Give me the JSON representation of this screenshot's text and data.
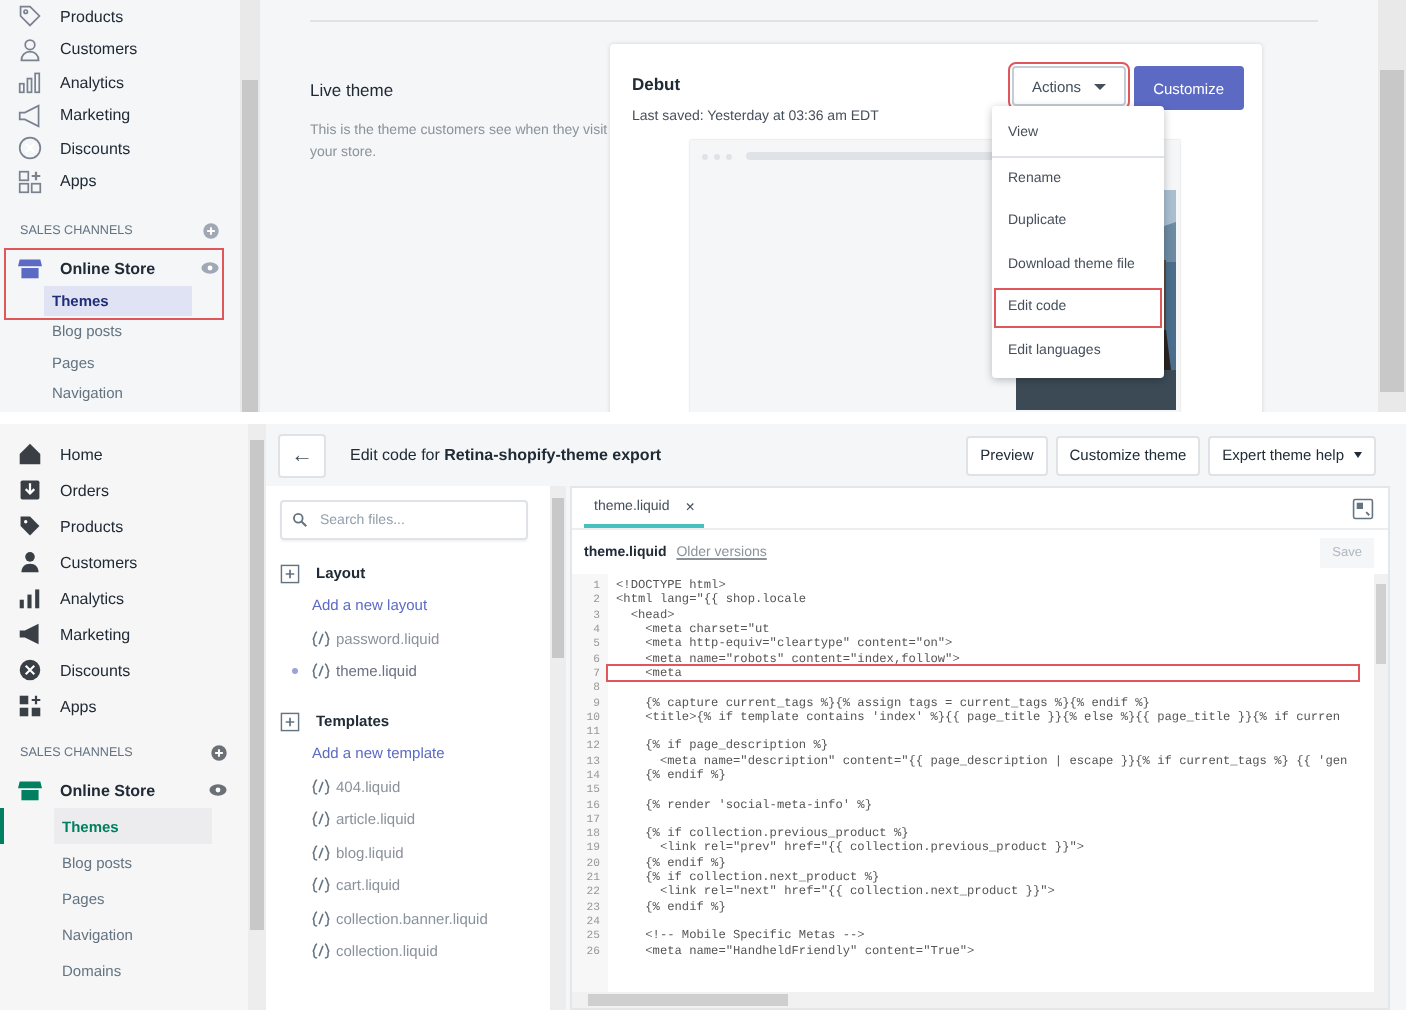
{
  "theme_admin": {
    "sidebar": {
      "items": [
        {
          "label": "Products"
        },
        {
          "label": "Customers"
        },
        {
          "label": "Analytics"
        },
        {
          "label": "Marketing"
        },
        {
          "label": "Discounts"
        },
        {
          "label": "Apps"
        }
      ],
      "section_title": "SALES CHANNELS",
      "channel": {
        "label": "Online Store",
        "highlighted": true,
        "children": [
          {
            "label": "Themes",
            "selected": true
          },
          {
            "label": "Blog posts",
            "selected": false
          },
          {
            "label": "Pages",
            "selected": false
          },
          {
            "label": "Navigation",
            "selected": false
          }
        ]
      }
    },
    "live_theme": {
      "heading": "Live theme",
      "description": "This is the theme customers see when they visit your store."
    },
    "theme_card": {
      "name": "Debut",
      "last_saved": "Last saved: Yesterday at 03:36 am EDT",
      "actions_button": {
        "label": "Actions",
        "highlighted": true
      },
      "customize_button": "Customize",
      "actions_menu": [
        {
          "label": "View",
          "highlighted": false
        },
        {
          "label": "Rename",
          "highlighted": false
        },
        {
          "label": "Duplicate",
          "highlighted": false
        },
        {
          "label": "Download theme file",
          "highlighted": false
        },
        {
          "label": "Edit code",
          "highlighted": true
        },
        {
          "label": "Edit languages",
          "highlighted": false
        }
      ]
    }
  },
  "code_editor": {
    "sidebar": {
      "items": [
        {
          "label": "Home"
        },
        {
          "label": "Orders"
        },
        {
          "label": "Products"
        },
        {
          "label": "Customers"
        },
        {
          "label": "Analytics"
        },
        {
          "label": "Marketing"
        },
        {
          "label": "Discounts"
        },
        {
          "label": "Apps"
        }
      ],
      "section_title": "SALES CHANNELS",
      "channel": {
        "label": "Online Store",
        "highlighted": false,
        "children": [
          {
            "label": "Themes",
            "selected": true
          },
          {
            "label": "Blog posts",
            "selected": false
          },
          {
            "label": "Pages",
            "selected": false
          },
          {
            "label": "Navigation",
            "selected": false
          },
          {
            "label": "Domains",
            "selected": false
          }
        ]
      }
    },
    "back_button": "←",
    "title": "Edit code for **Retina-shopify-theme export**",
    "header_buttons": [
      {
        "label": "Preview",
        "kind": "plain"
      },
      {
        "label": "Customize theme",
        "kind": "plain"
      },
      {
        "label": "Expert theme help",
        "kind": "dropdown"
      }
    ],
    "file_search": {
      "placeholder": "Search files..."
    },
    "folders": [
      {
        "name": "Layout",
        "add_link": "Add a new layout",
        "files": [
          {
            "name": "password.liquid",
            "selected": false
          },
          {
            "name": "theme.liquid",
            "selected": true
          }
        ]
      },
      {
        "name": "Templates",
        "add_link": "Add a new template",
        "files": [
          {
            "name": "404.liquid",
            "selected": false
          },
          {
            "name": "article.liquid",
            "selected": false
          },
          {
            "name": "blog.liquid",
            "selected": false
          },
          {
            "name": "cart.liquid",
            "selected": false
          },
          {
            "name": "collection.banner.liquid",
            "selected": false
          },
          {
            "name": "collection.liquid",
            "selected": false
          }
        ]
      }
    ],
    "tab": {
      "label": "theme.liquid",
      "close": "×"
    },
    "file_title": "theme.liquid",
    "older_versions_link": "Older versions",
    "save_button": {
      "label": "Save",
      "disabled": true
    },
    "code_lines": [
      {
        "number": "1",
        "code": "<!DOCTYPE html>",
        "highlighted": false
      },
      {
        "number": "2",
        "code": "<html lang=\"{{ shop.locale",
        "highlighted": false
      },
      {
        "number": "3",
        "code": "  <head>",
        "highlighted": false
      },
      {
        "number": "4",
        "code": "    <meta charset=\"ut",
        "highlighted": false
      },
      {
        "number": "5",
        "code": "    <meta http-equiv=\"cleartype\" content=\"on\">",
        "highlighted": false
      },
      {
        "number": "6",
        "code": "    <meta name=\"robots\" content=\"index,follow\">",
        "highlighted": false
      },
      {
        "number": "7",
        "code": "    <meta",
        "highlighted": true
      },
      {
        "number": "8",
        "highlighted": false
      },
      {
        "number": "9",
        "code": "    {% capture current_tags %}{% assign tags = current_tags %}{% endif %}",
        "highlighted": false
      },
      {
        "number": "10",
        "code": "    <title>{% if template contains 'index' %}{{ page_title }}{% else %}{{ page_title }}{% if curren",
        "highlighted": false
      },
      {
        "number": "11",
        "highlighted": false
      },
      {
        "number": "12",
        "code": "    {% if page_description %}",
        "highlighted": false
      },
      {
        "number": "13",
        "code": "      <meta name=\"description\" content=\"{{ page_description | escape }}{% if current_tags %} {{ 'gen",
        "highlighted": false
      },
      {
        "number": "14",
        "code": "    {% endif %}",
        "highlighted": false
      },
      {
        "number": "15",
        "highlighted": false
      },
      {
        "number": "16",
        "code": "    {% render 'social-meta-info' %}",
        "highlighted": false
      },
      {
        "number": "17",
        "highlighted": false
      },
      {
        "number": "18",
        "code": "    {% if collection.previous_product %}",
        "highlighted": false
      },
      {
        "number": "19",
        "code": "      <link rel=\"prev\" href=\"{{ collection.previous_product }}\">",
        "highlighted": false
      },
      {
        "number": "20",
        "code": "    {% endif %}",
        "highlighted": false
      },
      {
        "number": "21",
        "code": "    {% if collection.next_product %}",
        "highlighted": false
      },
      {
        "number": "22",
        "code": "      <link rel=\"next\" href=\"{{ collection.next_product }}\">",
        "highlighted": false
      },
      {
        "number": "23",
        "code": "    {% endif %}",
        "highlighted": false
      },
      {
        "number": "24",
        "highlighted": false
      },
      {
        "number": "25",
        "code": "    <!-- Mobile Specific Metas -->",
        "highlighted": false
      },
      {
        "number": "26",
        "code": "    <meta name=\"HandheldFriendly\" content=\"True\">",
        "highlighted": false
      }
    ]
  }
}
